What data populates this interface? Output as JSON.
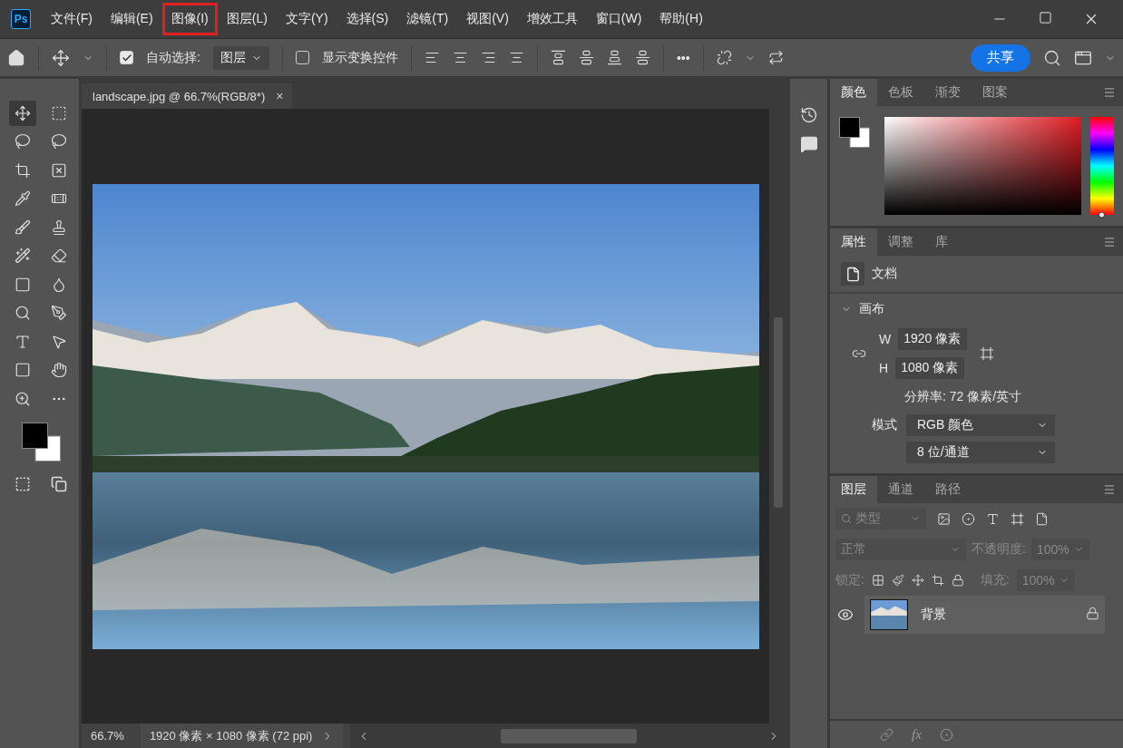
{
  "app_icon": "Ps",
  "menu": [
    {
      "label": "文件(F)",
      "highlighted": false
    },
    {
      "label": "编辑(E)",
      "highlighted": false
    },
    {
      "label": "图像(I)",
      "highlighted": true
    },
    {
      "label": "图层(L)",
      "highlighted": false
    },
    {
      "label": "文字(Y)",
      "highlighted": false
    },
    {
      "label": "选择(S)",
      "highlighted": false
    },
    {
      "label": "滤镜(T)",
      "highlighted": false
    },
    {
      "label": "视图(V)",
      "highlighted": false
    },
    {
      "label": "增效工具",
      "highlighted": false
    },
    {
      "label": "窗口(W)",
      "highlighted": false
    },
    {
      "label": "帮助(H)",
      "highlighted": false
    }
  ],
  "options_bar": {
    "auto_select": {
      "label": "自动选择:",
      "checked": true
    },
    "target": "图层",
    "transform_controls": {
      "label": "显示变换控件",
      "checked": false
    },
    "more": "•••",
    "share": "共享"
  },
  "document_tab": {
    "title": "landscape.jpg @ 66.7%(RGB/8*)",
    "close": "×"
  },
  "status_bar": {
    "zoom": "66.7%",
    "info": "1920 像素 × 1080 像素 (72 ppi)"
  },
  "color_panel": {
    "hue_slider": {
      "level": 0
    },
    "tabs": [
      {
        "label": "颜色",
        "selected": true
      },
      {
        "label": "色板",
        "selected": false
      },
      {
        "label": "渐变",
        "selected": false
      },
      {
        "label": "图案",
        "selected": false
      }
    ]
  },
  "properties_panel": {
    "tabs": [
      {
        "label": "属性",
        "selected": true
      },
      {
        "label": "调整",
        "selected": false
      },
      {
        "label": "库",
        "selected": false
      }
    ],
    "doc_label": "文档",
    "section": {
      "title": "画布",
      "expanded": true
    },
    "width": {
      "label": "W",
      "value": "1920 像素"
    },
    "height": {
      "label": "H",
      "value": "1080 像素"
    },
    "resolution": "分辨率: 72 像素/英寸",
    "mode_label": "模式",
    "mode": "RGB 颜色",
    "depth": "8 位/通道"
  },
  "layers_panel": {
    "tabs": [
      {
        "label": "图层",
        "selected": true
      },
      {
        "label": "通道",
        "selected": false
      },
      {
        "label": "路径",
        "selected": false
      }
    ],
    "filter": "类型",
    "blend": "正常",
    "opacity_label": "不透明度:",
    "opacity": "100%",
    "lock_label": "锁定:",
    "fill_label": "填充:",
    "fill": "100%",
    "fx": "fx",
    "layers": [
      {
        "name": "背景",
        "visible": true,
        "locked": true,
        "selected": true
      }
    ]
  }
}
